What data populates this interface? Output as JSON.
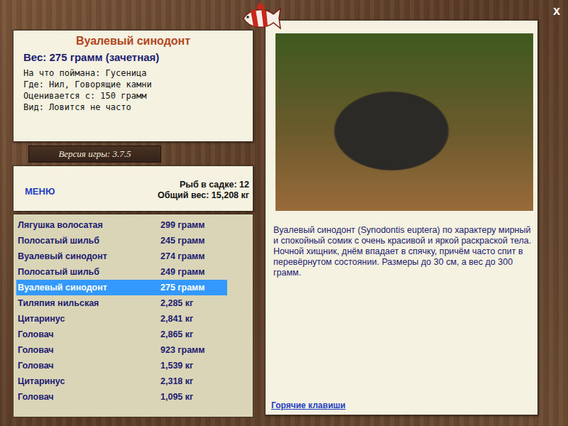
{
  "window": {
    "close": "x"
  },
  "catch": {
    "name": "Вуалевый синодонт",
    "weight": "Вес: 275 грамм (зачетная)",
    "details": [
      "На что поймана: Гусеница",
      "Где: Нил, Говорящие камни",
      "Оценивается с: 150 грамм",
      "Вид: Ловится не часто"
    ]
  },
  "version": "Версия игры: 3.7.5",
  "menu": "МЕНЮ",
  "summary": [
    "Рыб в садке: 12",
    "Общий вес: 15,208 кг"
  ],
  "fish_list": [
    {
      "name": "Лягушка волосатая",
      "weight": "299 грамм",
      "selected": false
    },
    {
      "name": "Полосатый шильб",
      "weight": "245 грамм",
      "selected": false
    },
    {
      "name": "Вуалевый синодонт",
      "weight": "274 грамм",
      "selected": false
    },
    {
      "name": "Полосатый шильб",
      "weight": "249 грамм",
      "selected": false
    },
    {
      "name": "Вуалевый синодонт",
      "weight": "275 грамм",
      "selected": true
    },
    {
      "name": "Тиляпия нильская",
      "weight": "2,285 кг",
      "selected": false
    },
    {
      "name": "Цитаринус",
      "weight": "2,841 кг",
      "selected": false
    },
    {
      "name": "Головач",
      "weight": "2,865 кг",
      "selected": false
    },
    {
      "name": "Головач",
      "weight": "923 грамм",
      "selected": false
    },
    {
      "name": "Головач",
      "weight": "1,539 кг",
      "selected": false
    },
    {
      "name": "Цитаринус",
      "weight": "2,318 кг",
      "selected": false
    },
    {
      "name": "Головач",
      "weight": "1,095 кг",
      "selected": false
    }
  ],
  "description": "Вуалевый синодонт (Synodontis euptera) по характеру мирный и спокойный сомик с очень красивой и яркой раскраской тела. Ночной хищник, днём впадает в спячку, причём часто спит в перевёрнутом состоянии. Размеры до 30 см, а вес до 300 грамм.",
  "hotkeys": "Горячие клавиши"
}
